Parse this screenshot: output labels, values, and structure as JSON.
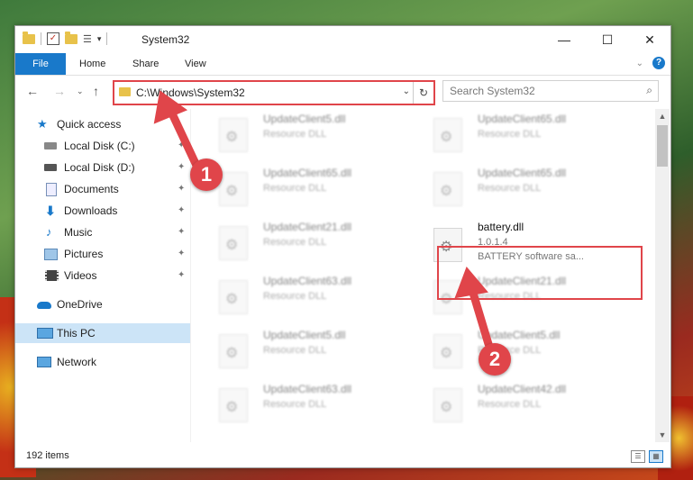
{
  "window": {
    "title": "System32",
    "min_glyph": "—",
    "max_glyph": "☐",
    "close_glyph": "✕"
  },
  "ribbon": {
    "tabs": [
      "File",
      "Home",
      "Share",
      "View"
    ],
    "chevron": "⌄",
    "help": "?"
  },
  "address": {
    "path": "C:\\Windows\\System32",
    "dropdown": "⌄",
    "refresh": "↻"
  },
  "search": {
    "placeholder": "Search System32",
    "icon": "⌕"
  },
  "sidebar": {
    "items": [
      {
        "label": "Quick access",
        "icon": "star-icon"
      },
      {
        "label": "Local Disk (C:)",
        "icon": "drive-icon",
        "pinned": true
      },
      {
        "label": "Local Disk (D:)",
        "icon": "drive-icon",
        "pinned": true
      },
      {
        "label": "Documents",
        "icon": "documents-icon",
        "pinned": true
      },
      {
        "label": "Downloads",
        "icon": "downloads-icon",
        "pinned": true
      },
      {
        "label": "Music",
        "icon": "music-icon",
        "pinned": true
      },
      {
        "label": "Pictures",
        "icon": "pictures-icon",
        "pinned": true
      },
      {
        "label": "Videos",
        "icon": "videos-icon",
        "pinned": true
      },
      {
        "label": "OneDrive",
        "icon": "cloud-icon"
      },
      {
        "label": "This PC",
        "icon": "computer-icon",
        "selected": true
      },
      {
        "label": "Network",
        "icon": "network-icon"
      }
    ],
    "pin_glyph": "📌"
  },
  "files": [
    {
      "name": "UpdateClient5.dll",
      "sub": "Resource DLL"
    },
    {
      "name": "UpdateClient65.dll",
      "sub": "Resource DLL"
    },
    {
      "name": "UpdateClient65.dll",
      "sub": "Resource DLL"
    },
    {
      "name": "UpdateClient65.dll",
      "sub": "Resource DLL"
    },
    {
      "name": "UpdateClient21.dll",
      "sub": "Resource DLL"
    },
    {
      "name": "battery.dll",
      "sub": "1.0.1.4",
      "sub2": "BATTERY software sa..."
    },
    {
      "name": "UpdateClient63.dll",
      "sub": "Resource DLL"
    },
    {
      "name": "UpdateClient21.dll",
      "sub": "Resource DLL"
    },
    {
      "name": "UpdateClient5.dll",
      "sub": "Resource DLL"
    },
    {
      "name": "UpdateClient5.dll",
      "sub": "Resource DLL"
    },
    {
      "name": "UpdateClient63.dll",
      "sub": "Resource DLL"
    },
    {
      "name": "UpdateClient42.dll",
      "sub": "Resource DLL"
    }
  ],
  "status": {
    "count": "192 items"
  },
  "callouts": [
    "1",
    "2"
  ],
  "colors": {
    "accent": "#1979ca",
    "highlight": "#e0454a",
    "selected": "#cce4f7"
  }
}
